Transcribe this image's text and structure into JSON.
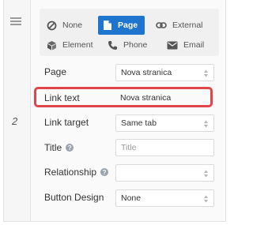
{
  "row_number": "2",
  "link_types": [
    {
      "label": "None",
      "icon": "no-link-icon",
      "active": false
    },
    {
      "label": "Page",
      "icon": "page-icon",
      "active": true
    },
    {
      "label": "External",
      "icon": "chain-link-icon",
      "active": false
    },
    {
      "label": "Element",
      "icon": "cube-icon",
      "active": false
    },
    {
      "label": "Phone",
      "icon": "phone-icon",
      "active": false
    },
    {
      "label": "Email",
      "icon": "envelope-icon",
      "active": false
    }
  ],
  "fields": {
    "page": {
      "label": "Page",
      "value": "Nova stranica"
    },
    "link_text": {
      "label": "Link text",
      "value": "Nova stranica"
    },
    "link_target": {
      "label": "Link target",
      "value": "Same tab"
    },
    "title": {
      "label": "Title",
      "placeholder": "Title",
      "value": ""
    },
    "relationship": {
      "label": "Relationship",
      "value": ""
    },
    "button_design": {
      "label": "Button Design",
      "value": "None"
    }
  },
  "colors": {
    "accent": "#1f74d0",
    "highlight": "#e0454a"
  }
}
